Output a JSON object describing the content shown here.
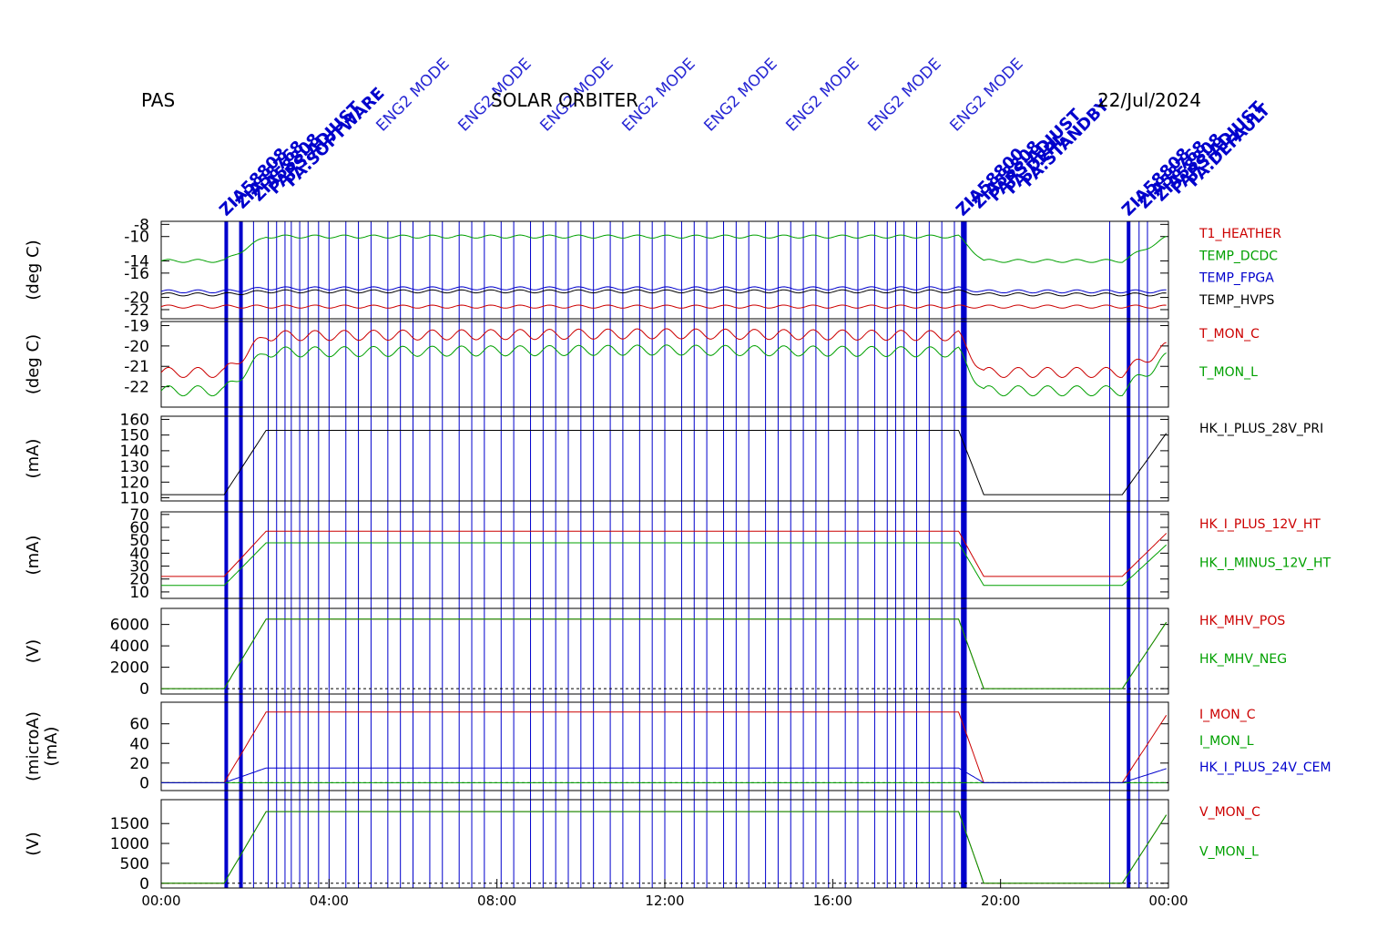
{
  "header": {
    "instrument": "PAS",
    "mission": "SOLAR ORBITER",
    "date": "22/Jul/2024"
  },
  "chart_data": [
    {
      "type": "line",
      "ylabel": "(deg C)",
      "ylim": [
        -23.5,
        -7.5
      ],
      "yticks": [
        -8,
        -10,
        -14,
        -16,
        -20,
        -22
      ],
      "series": [
        {
          "name": "T1_HEATHER",
          "color": "#cc0000",
          "values": [
            -21.5,
            -21.5,
            -21.5,
            -21.5,
            -21.5,
            -21.5,
            -21.5,
            -21.5
          ]
        },
        {
          "name": "TEMP_DCDC",
          "color": "#00a000",
          "values": [
            -14.0,
            -14.0,
            -10.0,
            -10.0,
            -10.0,
            -14.0,
            -14.0,
            -10.0
          ]
        },
        {
          "name": "TEMP_FPGA",
          "color": "#0000cc",
          "values": [
            -19.0,
            -19.0,
            -18.5,
            -18.5,
            -18.5,
            -19.0,
            -19.0,
            -19.0
          ]
        },
        {
          "name": "TEMP_HVPS",
          "color": "#000000",
          "values": [
            -19.5,
            -19.5,
            -19.0,
            -19.0,
            -19.0,
            -19.5,
            -19.5,
            -19.5
          ]
        }
      ]
    },
    {
      "type": "line",
      "ylabel": "(deg C)",
      "ylim": [
        -23,
        -18.8
      ],
      "yticks": [
        -19,
        -20,
        -21,
        -22
      ],
      "series": [
        {
          "name": "T_MON_C",
          "color": "#cc0000",
          "values": [
            -21.3,
            -21.3,
            -19.5,
            -19.4,
            -19.5,
            -21.3,
            -21.3,
            -20.0
          ]
        },
        {
          "name": "T_MON_L",
          "color": "#00a000",
          "values": [
            -22.2,
            -22.2,
            -20.3,
            -20.2,
            -20.3,
            -22.2,
            -22.2,
            -20.5
          ]
        }
      ]
    },
    {
      "type": "line",
      "ylabel": "(mA)",
      "ylim": [
        108,
        162
      ],
      "yticks": [
        160,
        150,
        140,
        130,
        120,
        110
      ],
      "series": [
        {
          "name": "HK_I_PLUS_28V_PRI",
          "color": "#000000",
          "values": [
            112,
            112,
            153,
            153,
            153,
            112,
            112,
            153
          ]
        }
      ]
    },
    {
      "type": "line",
      "ylabel": "(mA)",
      "ylim": [
        5,
        72
      ],
      "yticks": [
        70,
        60,
        50,
        40,
        30,
        20,
        10
      ],
      "series": [
        {
          "name": "HK_I_PLUS_12V_HT",
          "color": "#cc0000",
          "values": [
            22,
            22,
            57,
            57,
            57,
            22,
            22,
            57
          ]
        },
        {
          "name": "HK_I_MINUS_12V_HT",
          "color": "#00a000",
          "values": [
            15,
            15,
            48,
            48,
            48,
            15,
            15,
            48
          ]
        }
      ]
    },
    {
      "type": "line",
      "ylabel": "(V)",
      "ylim": [
        -500,
        7500
      ],
      "yticks": [
        6000,
        4000,
        2000,
        0
      ],
      "series": [
        {
          "name": "HK_MHV_POS",
          "color": "#cc0000",
          "values": [
            0,
            0,
            6500,
            6500,
            6500,
            0,
            0,
            6500
          ]
        },
        {
          "name": "HK_MHV_NEG",
          "color": "#00a000",
          "values": [
            0,
            0,
            6500,
            6500,
            6500,
            0,
            0,
            6500
          ]
        }
      ]
    },
    {
      "type": "line",
      "ylabel": "(microA)",
      "ylabel2": "(mA)",
      "ylim": [
        -8,
        82
      ],
      "yticks": [
        60,
        40,
        20,
        0
      ],
      "series": [
        {
          "name": "I_MON_C",
          "color": "#cc0000",
          "values": [
            0,
            0,
            72,
            72,
            72,
            0,
            0,
            72
          ]
        },
        {
          "name": "I_MON_L",
          "color": "#00a000",
          "values": [
            0,
            0,
            0,
            0,
            0,
            0,
            0,
            0
          ]
        },
        {
          "name": "HK_I_PLUS_24V_CEM",
          "color": "#0000cc",
          "values": [
            0,
            0,
            15,
            15,
            15,
            0,
            0,
            15
          ]
        }
      ]
    },
    {
      "type": "line",
      "ylabel": "(V)",
      "ylim": [
        -120,
        2100
      ],
      "yticks": [
        1500,
        1000,
        500,
        0
      ],
      "series": [
        {
          "name": "V_MON_C",
          "color": "#cc0000",
          "values": [
            0,
            0,
            1800,
            1800,
            1800,
            0,
            0,
            1800
          ]
        },
        {
          "name": "V_MON_L",
          "color": "#00a000",
          "values": [
            0,
            0,
            1800,
            1800,
            1800,
            0,
            0,
            1800
          ]
        }
      ]
    }
  ],
  "x_axis": {
    "unit": "hours",
    "xlim": [
      0,
      24
    ],
    "tick_labels": [
      "00:00",
      "04:00",
      "08:00",
      "12:00",
      "16:00",
      "20:00",
      "00:00"
    ],
    "tick_values": [
      0,
      4,
      8,
      12,
      16,
      20,
      24
    ]
  },
  "event_markers": {
    "color": "#0000cc",
    "thick_hours": [
      1.55,
      1.9,
      19.1,
      19.15,
      23.05
    ],
    "thin_hours": [
      2.2,
      2.55,
      2.75,
      2.95,
      3.1,
      3.3,
      3.5,
      3.75,
      4.0,
      4.4,
      4.7,
      5.0,
      5.4,
      5.7,
      6.0,
      6.4,
      6.7,
      7.1,
      7.4,
      7.7,
      8.1,
      8.4,
      8.8,
      9.1,
      9.4,
      9.7,
      10.0,
      10.3,
      10.7,
      11.0,
      11.4,
      11.7,
      12.0,
      12.4,
      12.7,
      13.0,
      13.4,
      13.7,
      14.0,
      14.4,
      14.7,
      15.0,
      15.3,
      15.6,
      15.9,
      16.3,
      16.6,
      17.0,
      17.3,
      17.5,
      17.7,
      18.0,
      18.3,
      18.6,
      18.9,
      22.6,
      23.3,
      23.5
    ],
    "label_groups": [
      {
        "hour": 1.55,
        "labels": [
          "ZIA58808",
          "ZIA58768",
          "ZIA58808",
          "PAPS:ADJUST",
          "PA:SOFTWARE"
        ]
      },
      {
        "hour": 19.1,
        "labels": [
          "ZIA58800",
          "ZIA58808",
          "PAPS:ADJUST",
          "PA:DEPL",
          "PA:STANDBY"
        ]
      },
      {
        "hour": 23.05,
        "labels": [
          "ZIA58808",
          "ZIA58768",
          "ZIA58808",
          "PAPS:ADJUST",
          "PA:DEFAULT"
        ]
      }
    ],
    "event_labels": [
      "ENG2 MODE",
      "ENG2 MODE",
      "ENG2 MODE",
      "ENG2 MODE",
      "ENG2 MODE",
      "ENG2 MODE",
      "ENG2 MODE",
      "ENG2 MODE"
    ]
  }
}
